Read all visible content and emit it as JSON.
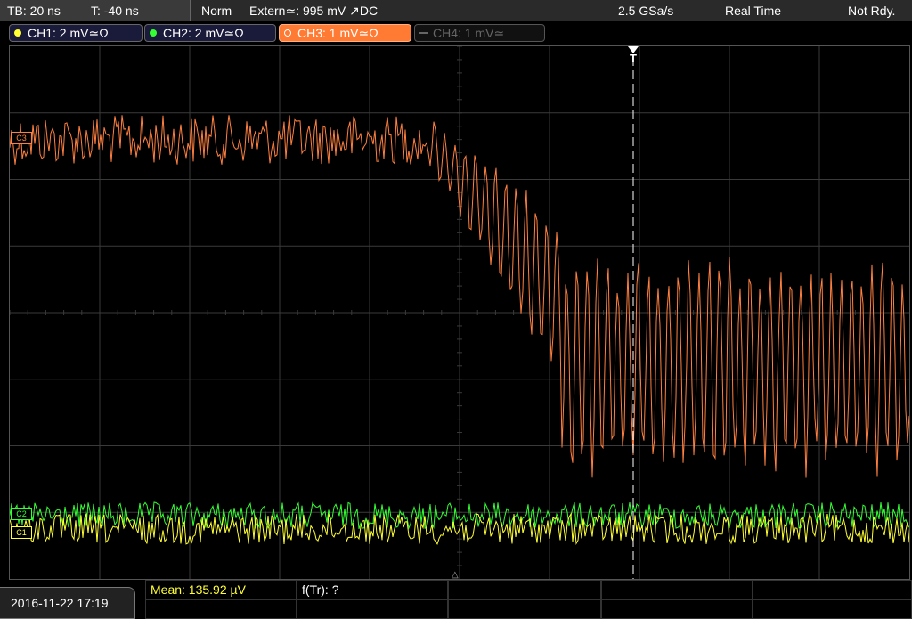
{
  "status": {
    "timebase": "TB: 20 ns",
    "trigger_time": "T: -40 ns",
    "trigger_mode": "Norm",
    "trigger_source": "Extern≃: 995 mV ↗DC",
    "sample_rate": "2.5 GSa/s",
    "acq_mode": "Real Time",
    "run_state": "Not Rdy."
  },
  "channels": [
    {
      "label": "CH1: 2 mV≃Ω",
      "color": "#ffff33"
    },
    {
      "label": "CH2: 2 mV≃Ω",
      "color": "#33ff33"
    },
    {
      "label": "CH3: 1 mV≃Ω",
      "color": "#ff8040"
    },
    {
      "label": "CH4: 1 mV≃",
      "color": "#888888"
    }
  ],
  "markers": {
    "trigger_marker": "T",
    "ch3_ref": "C3",
    "ch2_ref": "C2",
    "ch1_ref": "C1"
  },
  "footer": {
    "datetime": "2016-11-22 17:19",
    "mean": "Mean: 135.92 µV",
    "rise_time": "f(Tr): ?"
  },
  "colors": {
    "ch1": "#ffff33",
    "ch2": "#33ff33",
    "ch3": "#ff8040",
    "grid": "#3a3a3a"
  }
}
